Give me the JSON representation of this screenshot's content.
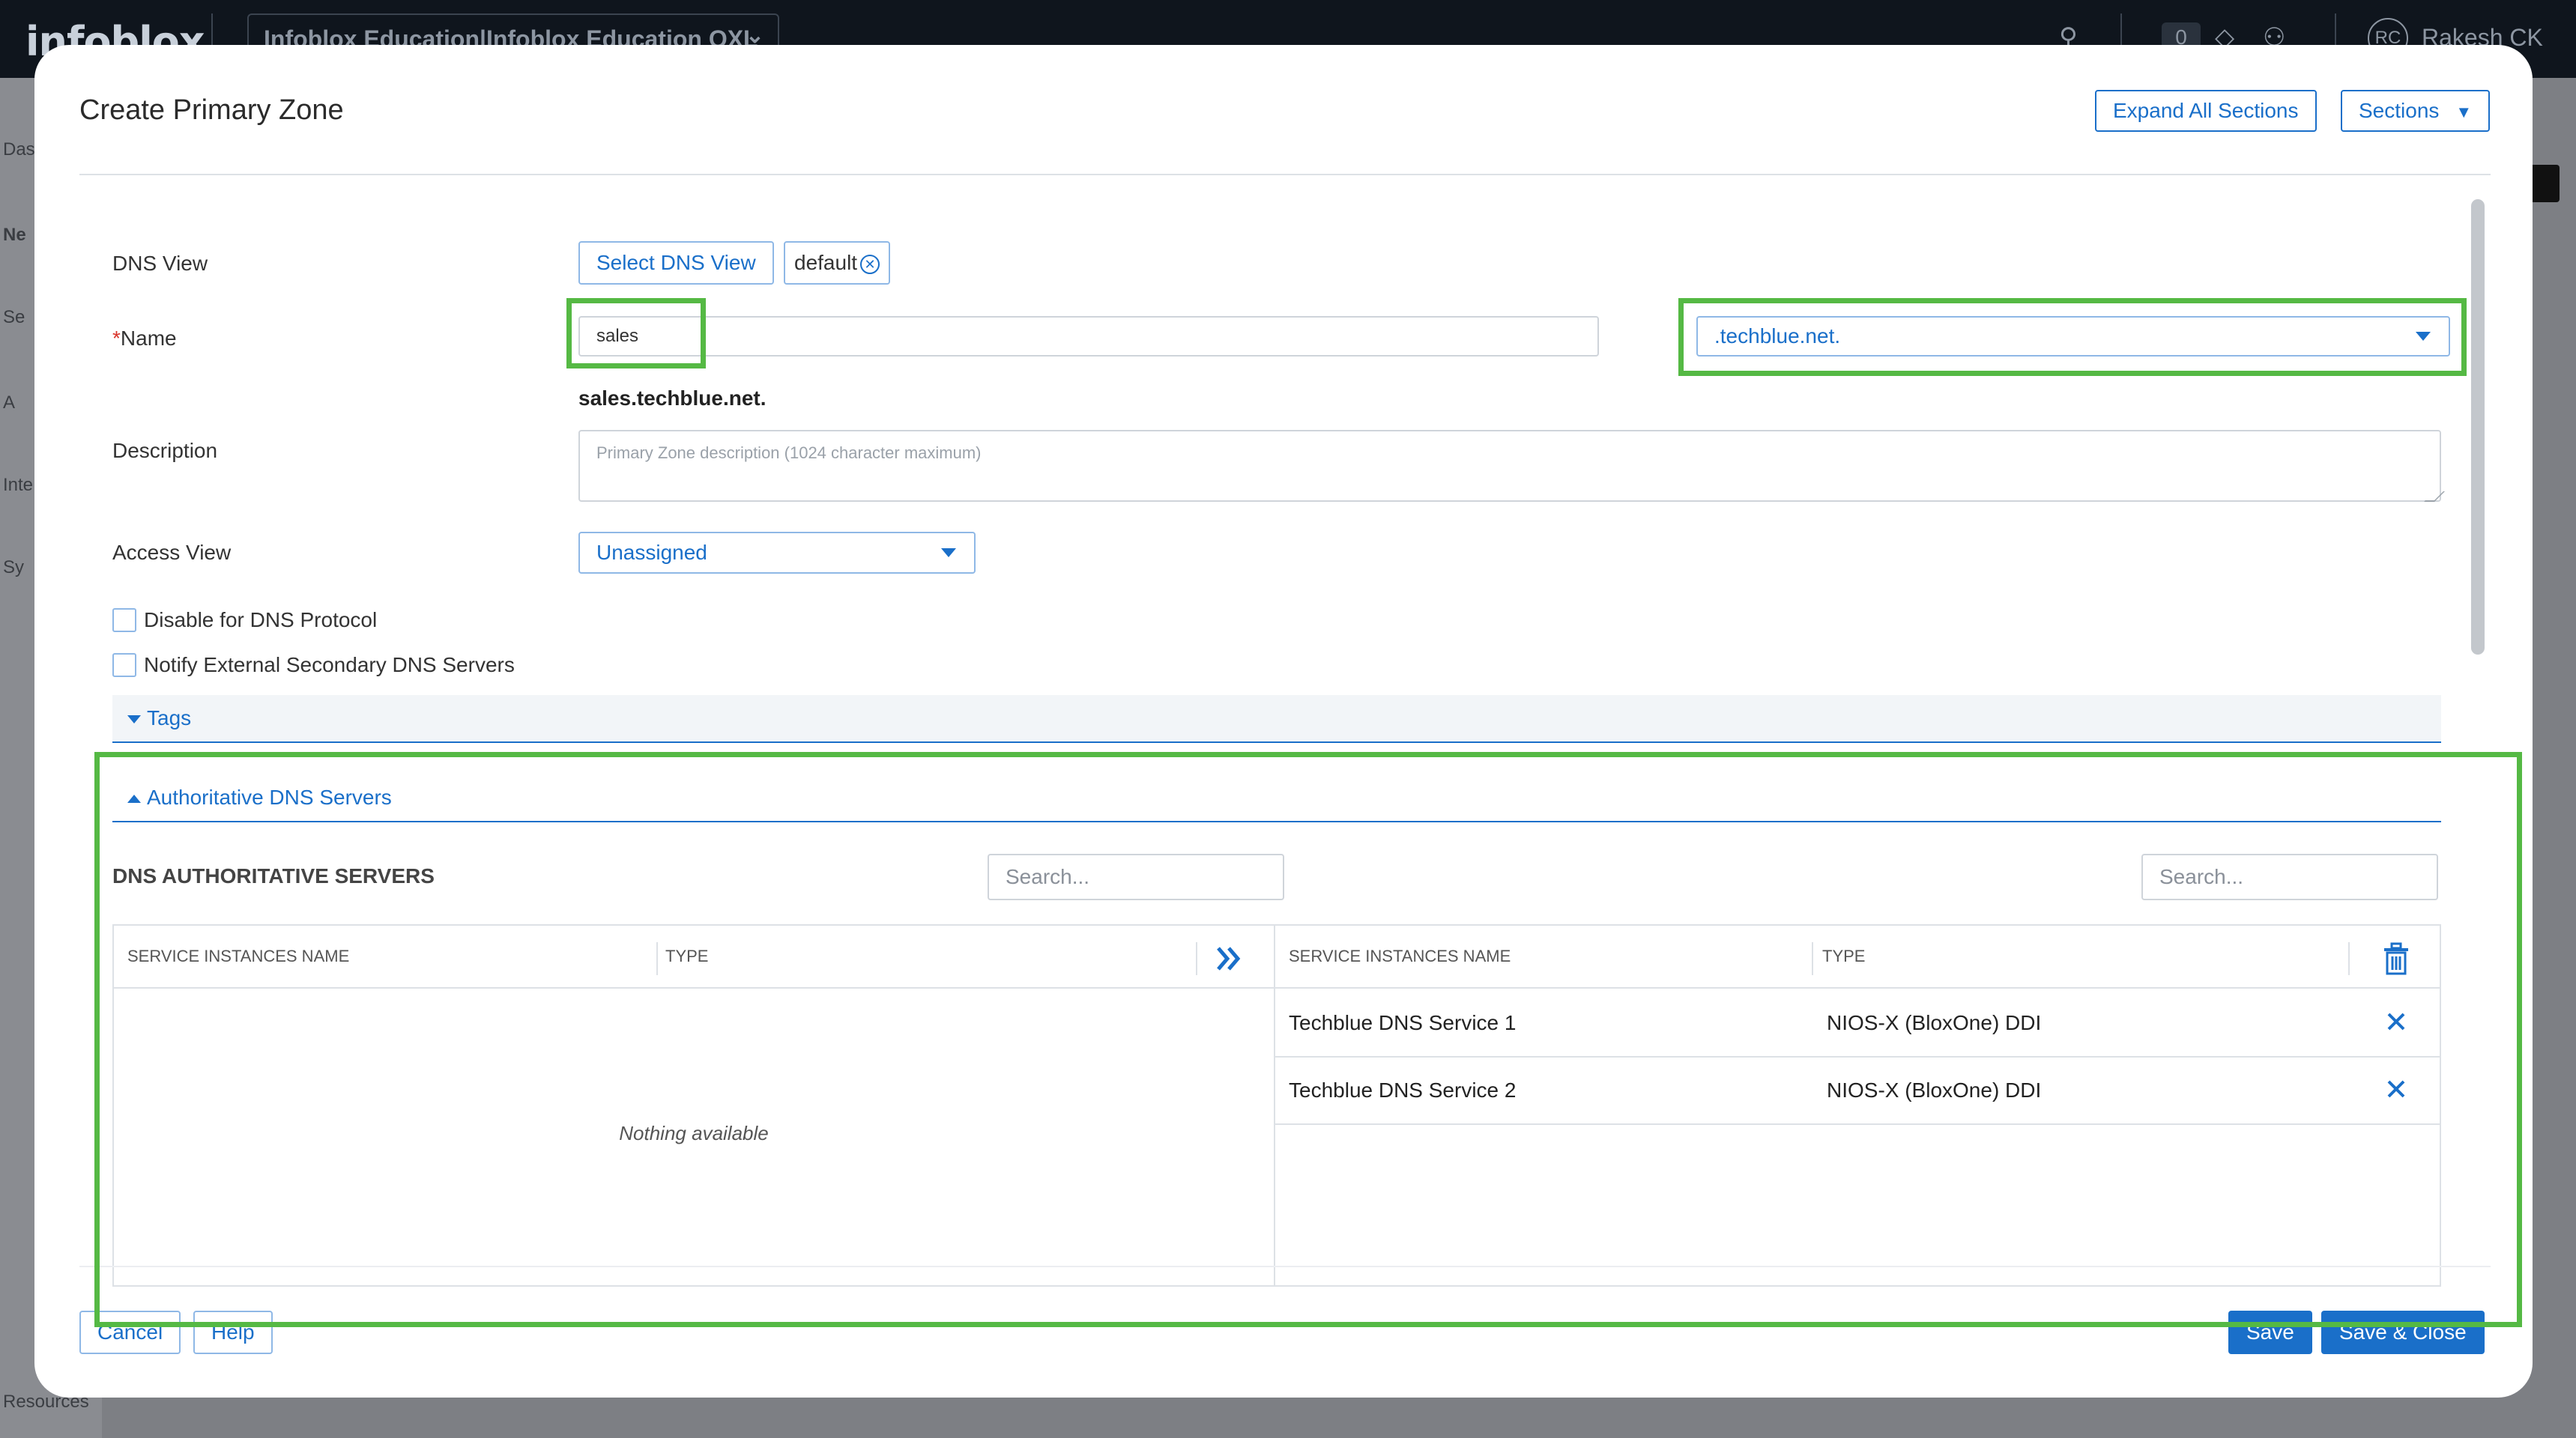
{
  "background": {
    "logo": "infoblox",
    "workspace": "Infoblox Education|Infoblox Education OXL",
    "notification_count": "0",
    "user_initials": "RC",
    "user_name": "Rakesh CK",
    "nav_items": [
      "Das",
      "Ne",
      "Se",
      "A",
      "Inte",
      "Sy",
      "Resources"
    ]
  },
  "modal": {
    "title": "Create Primary Zone",
    "expand_all_label": "Expand All Sections",
    "sections_label": "Sections",
    "dns_view": {
      "label": "DNS View",
      "select_button": "Select DNS View",
      "selected_chip": "default"
    },
    "name": {
      "required_mark": "*",
      "label": "Name",
      "value": "sales",
      "parent_zone": ".techblue.net.",
      "fqdn_preview": "sales.techblue.net."
    },
    "description": {
      "label": "Description",
      "placeholder": "Primary Zone description (1024 character maximum)"
    },
    "access_view": {
      "label": "Access View",
      "value": "Unassigned"
    },
    "checkboxes": {
      "disable_dns": "Disable for DNS Protocol",
      "notify_secondary": "Notify External Secondary DNS Servers"
    },
    "tags_section": "Tags",
    "auth_section": "Authoritative DNS Servers",
    "servers": {
      "title": "DNS AUTHORITATIVE SERVERS",
      "search_placeholder": "Search...",
      "available": {
        "col_name": "SERVICE INSTANCES NAME",
        "col_type": "TYPE",
        "empty_text": "Nothing available"
      },
      "selected": {
        "col_name": "SERVICE INSTANCES NAME",
        "col_type": "TYPE",
        "rows": [
          {
            "name": "Techblue DNS Service 1",
            "type": "NIOS-X (BloxOne) DDI"
          },
          {
            "name": "Techblue DNS Service 2",
            "type": "NIOS-X (BloxOne) DDI"
          }
        ]
      }
    },
    "footer": {
      "cancel": "Cancel",
      "help": "Help",
      "save": "Save",
      "save_close": "Save & Close"
    }
  },
  "colors": {
    "accent": "#1a6fc9",
    "highlight": "#55b944",
    "overlay": "#7d7f84"
  }
}
